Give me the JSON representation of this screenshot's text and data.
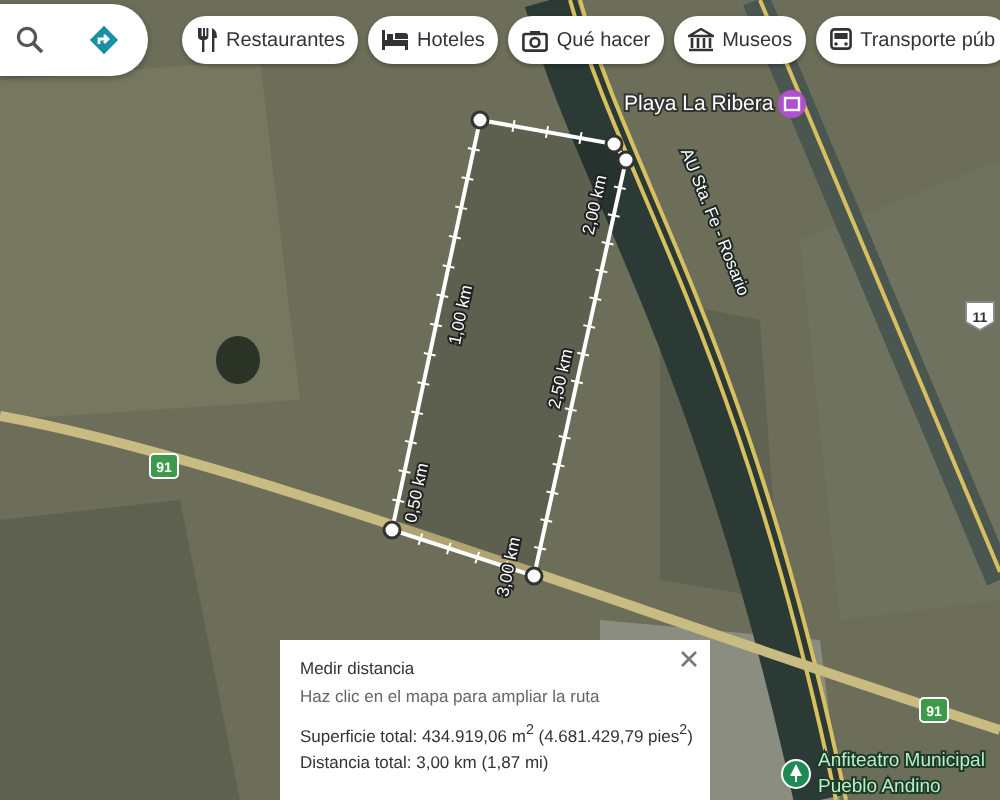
{
  "category_chips": [
    {
      "kind": "restaurants",
      "label": "Restaurantes"
    },
    {
      "kind": "hotels",
      "label": "Hoteles"
    },
    {
      "kind": "things_to_do",
      "label": "Qué hacer"
    },
    {
      "kind": "museums",
      "label": "Museos"
    },
    {
      "kind": "transit",
      "label": "Transporte púb"
    }
  ],
  "map": {
    "place_labels": [
      {
        "kind": "museum",
        "name": "Playa La Ribera"
      },
      {
        "kind": "park",
        "name": "Anfiteatro Municipal Pueblo Andino"
      }
    ],
    "road_labels": [
      "AU Sta. Fe - Rosario"
    ],
    "route_shields": [
      {
        "kind": "national",
        "number": "91"
      },
      {
        "kind": "national",
        "number": "91"
      },
      {
        "kind": "highway",
        "number": "11"
      }
    ],
    "measure_labels": [
      "0,50 km",
      "1,00 km",
      "2,00 km",
      "2,50 km",
      "3,00 km"
    ]
  },
  "measure_panel": {
    "title": "Medir distancia",
    "hint": "Haz clic en el mapa para ampliar la ruta",
    "area": "Superficie total: 434.919,06 m$^{2}$ (4.681.429,79 pies$^{2}$)",
    "distance": "Distancia total: 3,00 km (1,87 mi)"
  }
}
